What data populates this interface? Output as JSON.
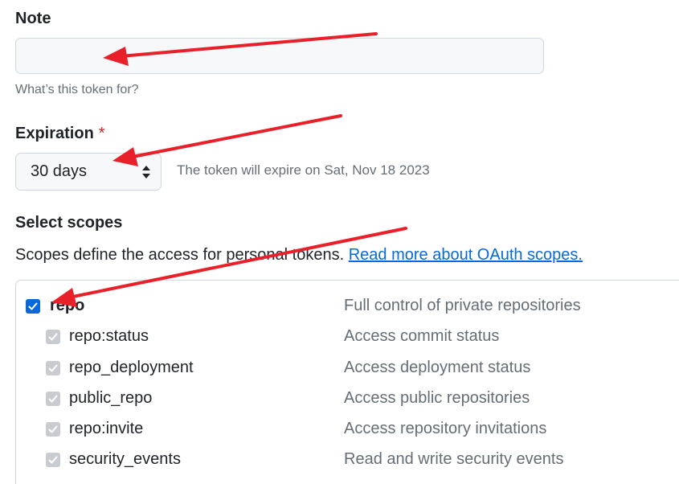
{
  "note": {
    "label": "Note",
    "value": "",
    "placeholder": "",
    "hint": "What’s this token for?"
  },
  "expiration": {
    "label": "Expiration",
    "required_mark": "*",
    "selected": "30 days",
    "expire_text": "The token will expire on Sat, Nov 18 2023"
  },
  "scopes": {
    "label": "Select scopes",
    "description": "Scopes define the access for personal tokens.",
    "link_text": "Read more about OAuth scopes.",
    "main": {
      "name": "repo",
      "description": "Full control of private repositories",
      "checked": true
    },
    "items": [
      {
        "name": "repo:status",
        "description": "Access commit status",
        "checked": true
      },
      {
        "name": "repo_deployment",
        "description": "Access deployment status",
        "checked": true
      },
      {
        "name": "public_repo",
        "description": "Access public repositories",
        "checked": true
      },
      {
        "name": "repo:invite",
        "description": "Access repository invitations",
        "checked": true
      },
      {
        "name": "security_events",
        "description": "Read and write security events",
        "checked": true
      }
    ]
  },
  "colors": {
    "accent": "#0969da",
    "annotation_arrow": "#e8202a",
    "required": "#d1242f"
  },
  "icons": {
    "select": "up-down-chevron-icon",
    "checkbox": "check-icon",
    "annotation": "red-arrow-icon"
  }
}
